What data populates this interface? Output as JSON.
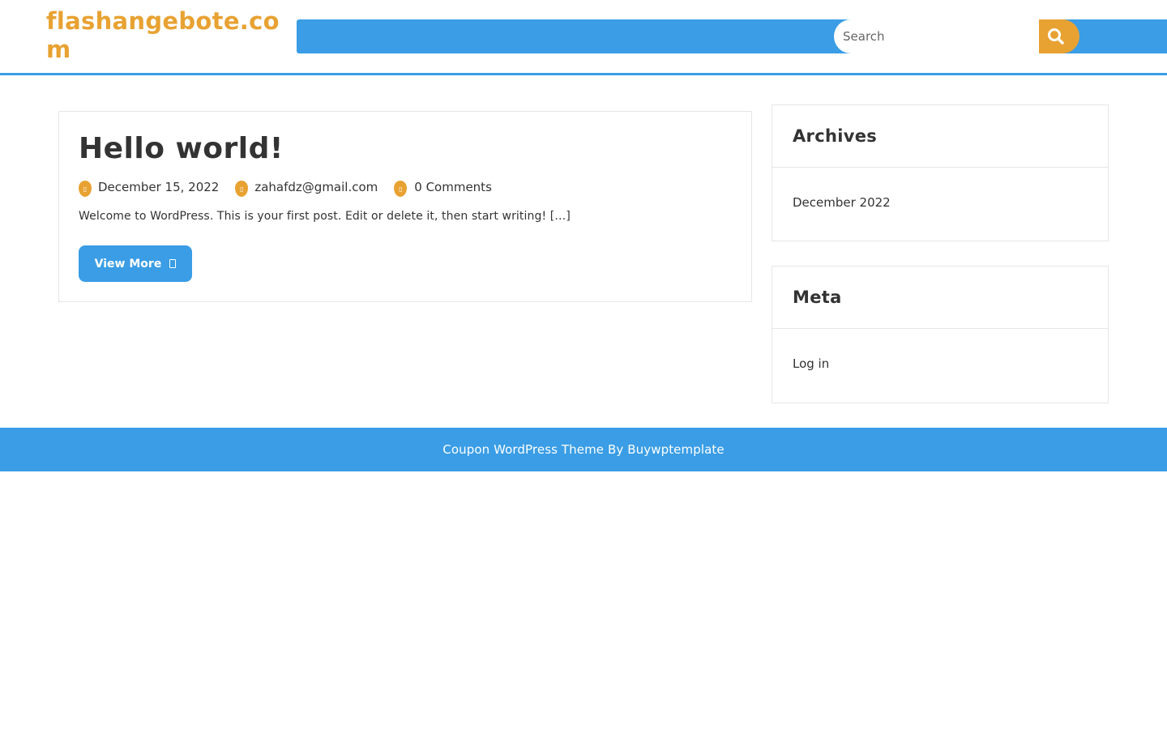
{
  "header": {
    "site_title": "flashangebote.com",
    "search_placeholder": "Search"
  },
  "post": {
    "title": "Hello world!",
    "date": "December 15, 2022",
    "author": "zahafdz@gmail.com",
    "comments": "0 Comments",
    "excerpt": "Welcome to WordPress. This is your first post. Edit or delete it, then start writing! […]",
    "view_more_label": "View More"
  },
  "sidebar": {
    "archives": {
      "title": "Archives",
      "items": [
        "December 2022"
      ]
    },
    "meta": {
      "title": "Meta",
      "items": [
        "Log in"
      ]
    }
  },
  "footer": {
    "credit": "Coupon WordPress Theme By Buywptemplate"
  },
  "colors": {
    "primary_blue": "#3a9de5",
    "accent_orange": "#e8a232",
    "text_dark": "#333333"
  }
}
